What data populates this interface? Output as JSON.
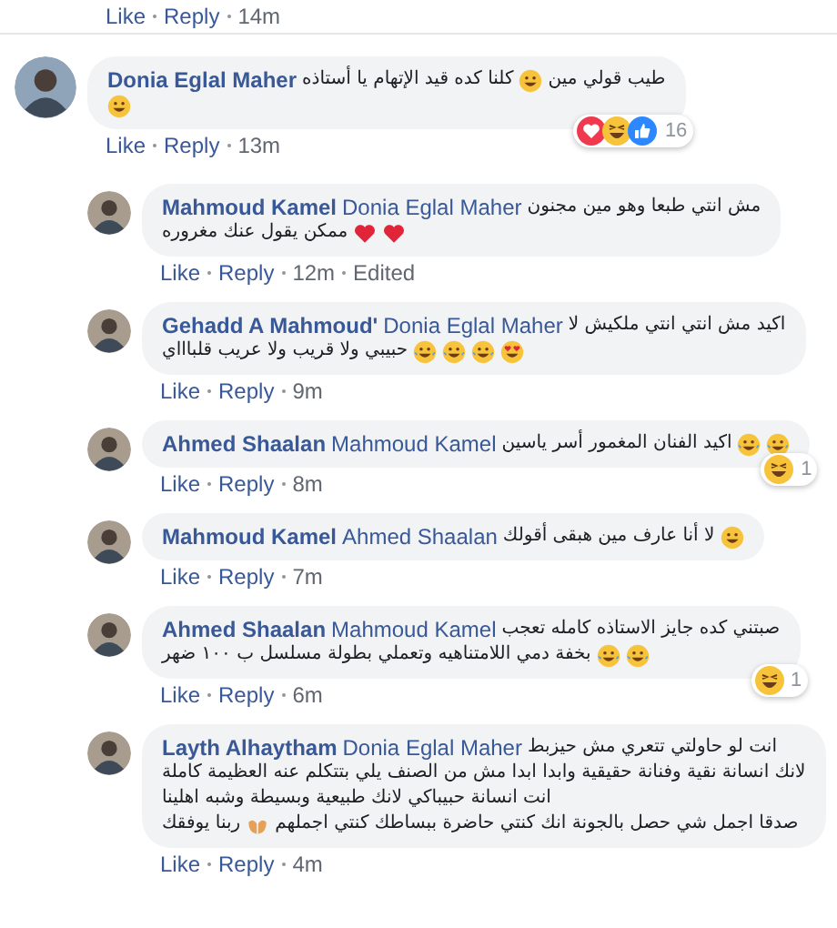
{
  "top_meta": {
    "like": "Like",
    "reply": "Reply",
    "time": "14m"
  },
  "comments": [
    {
      "name": "Donia Eglal Maher",
      "lines": [
        [
          {
            "kind": "text",
            "text": "طيب قولي مين"
          },
          {
            "kind": "grin"
          },
          {
            "kind": "text",
            "text": "كلنا كده قيد الإتهام يا أستاذه"
          }
        ],
        [
          {
            "kind": "grin"
          }
        ]
      ],
      "reactions": {
        "icons": [
          {
            "kind": "love"
          },
          {
            "kind": "haha"
          },
          {
            "kind": "like"
          }
        ],
        "count": "16"
      },
      "like": "Like",
      "reply": "Reply",
      "time": "13m",
      "replies": [
        {
          "name": "Mahmoud Kamel",
          "mention": "Donia Eglal Maher",
          "lines": [
            [
              {
                "kind": "text",
                "text": "مش انتي طبعا وهو مين مجنون"
              }
            ],
            [
              {
                "kind": "heart"
              },
              {
                "kind": "heart"
              },
              {
                "kind": "text",
                "text": "ممكن يقول عنك مغروره"
              }
            ]
          ],
          "like": "Like",
          "reply": "Reply",
          "time": "12m",
          "edited": "Edited"
        },
        {
          "name": "Gehadd A Mahmoud'",
          "mention": "Donia Eglal Maher",
          "lines": [
            [
              {
                "kind": "text",
                "text": "اكيد مش انتي انتي ملكيش لا"
              }
            ],
            [
              {
                "kind": "hearteyes"
              },
              {
                "kind": "tears"
              },
              {
                "kind": "tears"
              },
              {
                "kind": "tears"
              },
              {
                "kind": "text",
                "text": "حبيبي ولا قريب ولا عريب قلباااي"
              }
            ]
          ],
          "like": "Like",
          "reply": "Reply",
          "time": "9m"
        },
        {
          "name": "Ahmed Shaalan",
          "mention": "Mahmoud Kamel",
          "lines": [
            [
              {
                "kind": "tears"
              },
              {
                "kind": "tears"
              },
              {
                "kind": "text",
                "text": "اكيد الفنان المغمور أسر ياسين"
              }
            ]
          ],
          "reactions": {
            "icons": [
              {
                "kind": "haha"
              }
            ],
            "count": "1"
          },
          "like": "Like",
          "reply": "Reply",
          "time": "8m"
        },
        {
          "name": "Mahmoud Kamel",
          "mention": "Ahmed Shaalan",
          "lines": [
            [
              {
                "kind": "grin"
              },
              {
                "kind": "text",
                "text": "لا أنا عارف مين هبقى أقولك"
              }
            ]
          ],
          "like": "Like",
          "reply": "Reply",
          "time": "7m"
        },
        {
          "name": "Ahmed Shaalan",
          "mention": "Mahmoud Kamel",
          "lines": [
            [
              {
                "kind": "text",
                "text": "صبتني كده جايز الاستاذه كامله تعجب"
              }
            ],
            [
              {
                "kind": "tears"
              },
              {
                "kind": "tears"
              },
              {
                "kind": "text",
                "text": "بخفة دمي اللامتناهيه وتعملي بطولة مسلسل ب ١٠٠ ضهر"
              }
            ]
          ],
          "reactions": {
            "icons": [
              {
                "kind": "haha"
              }
            ],
            "count": "1"
          },
          "like": "Like",
          "reply": "Reply",
          "time": "6m"
        },
        {
          "name": "Layth Alhaytham",
          "mention": "Donia Eglal Maher",
          "lines": [
            [
              {
                "kind": "text",
                "text": "انت لو حاولتي تتعري مش حيزبط"
              }
            ],
            [
              {
                "kind": "text",
                "text": "لانك انسانة نقية وفنانة حقيقية وابدا ابدا مش من الصنف يلي بتتكلم عنه العظيمة كاملة"
              }
            ],
            [
              {
                "kind": "text",
                "text": "انت انسانة حبيباكي لانك طبيعية وبسيطة وشبه اهلينا"
              }
            ],
            [
              {
                "kind": "text",
                "text": "صدقا اجمل شي حصل بالجونة انك كنتي حاضرة ببساطك كنتي اجملهم"
              },
              {
                "kind": "hands"
              },
              {
                "kind": "text",
                "text": "ربنا يوفقك"
              }
            ]
          ],
          "like": "Like",
          "reply": "Reply",
          "time": "4m"
        }
      ]
    }
  ]
}
